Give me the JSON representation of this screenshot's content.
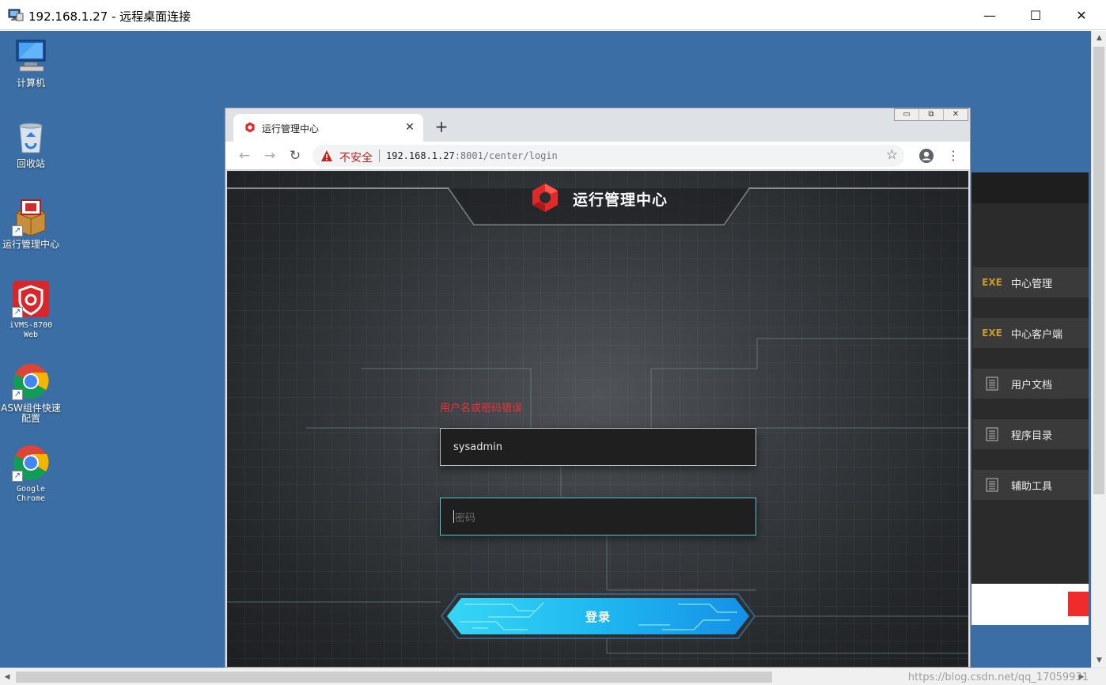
{
  "rdp_window": {
    "title": "192.168.1.27 - 远程桌面连接",
    "minimize": "—",
    "maximize": "☐",
    "close": "✕"
  },
  "desktop": {
    "icons": [
      {
        "label": "计算机",
        "icon": "computer-icon"
      },
      {
        "label": "回收站",
        "icon": "recycle-bin-icon"
      },
      {
        "label": "运行管理中心",
        "icon": "package-icon"
      },
      {
        "label": "iVMS-8700 Web",
        "icon": "ivms-shield-icon"
      },
      {
        "label": "ASW组件快速配置",
        "icon": "chrome-icon"
      },
      {
        "label": "Google Chrome",
        "icon": "chrome-icon"
      }
    ]
  },
  "side_panel": {
    "items": [
      {
        "badge": "EXE",
        "label": "中心管理"
      },
      {
        "badge": "EXE",
        "label": "中心客户端"
      },
      {
        "badge": "doc",
        "label": "用户文档"
      },
      {
        "badge": "doc",
        "label": "程序目录"
      },
      {
        "badge": "doc",
        "label": "辅助工具"
      }
    ]
  },
  "browser": {
    "tab_title": "运行管理中心",
    "tab_close": "✕",
    "new_tab": "+",
    "mini_controls": [
      "▭",
      "⧉",
      "✕"
    ],
    "back": "←",
    "forward": "→",
    "reload": "↻",
    "security_label": "不安全",
    "url_host": "192.168.1.27",
    "url_rest": ":8001/center/login",
    "star": "☆",
    "menu": "⋮"
  },
  "login": {
    "title": "运行管理中心",
    "error": "用户名或密码错误",
    "username_value": "sysadmin",
    "password_placeholder": "密码",
    "submit_label": "登录"
  },
  "watermark": "https://blog.csdn.net/qq_17059931",
  "colors": {
    "desktop_bg": "#3a6ea5",
    "error_red": "#e8333a",
    "brand_red": "#e02a2a",
    "button_cyan": "#1fb8f0"
  }
}
